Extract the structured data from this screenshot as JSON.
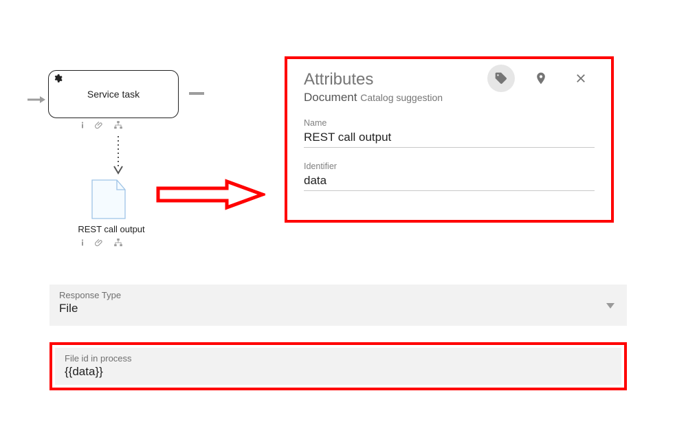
{
  "diagram": {
    "task_label": "Service task",
    "document_label": "REST call output"
  },
  "attributes": {
    "panel_title": "Attributes",
    "document_word": "Document",
    "document_sub": "Catalog suggestion",
    "name_label": "Name",
    "name_value": "REST call output",
    "identifier_label": "Identifier",
    "identifier_value": "data"
  },
  "form": {
    "response_type_label": "Response Type",
    "response_type_value": "File",
    "file_id_label": "File id in process",
    "file_id_value": "{{data}}"
  }
}
